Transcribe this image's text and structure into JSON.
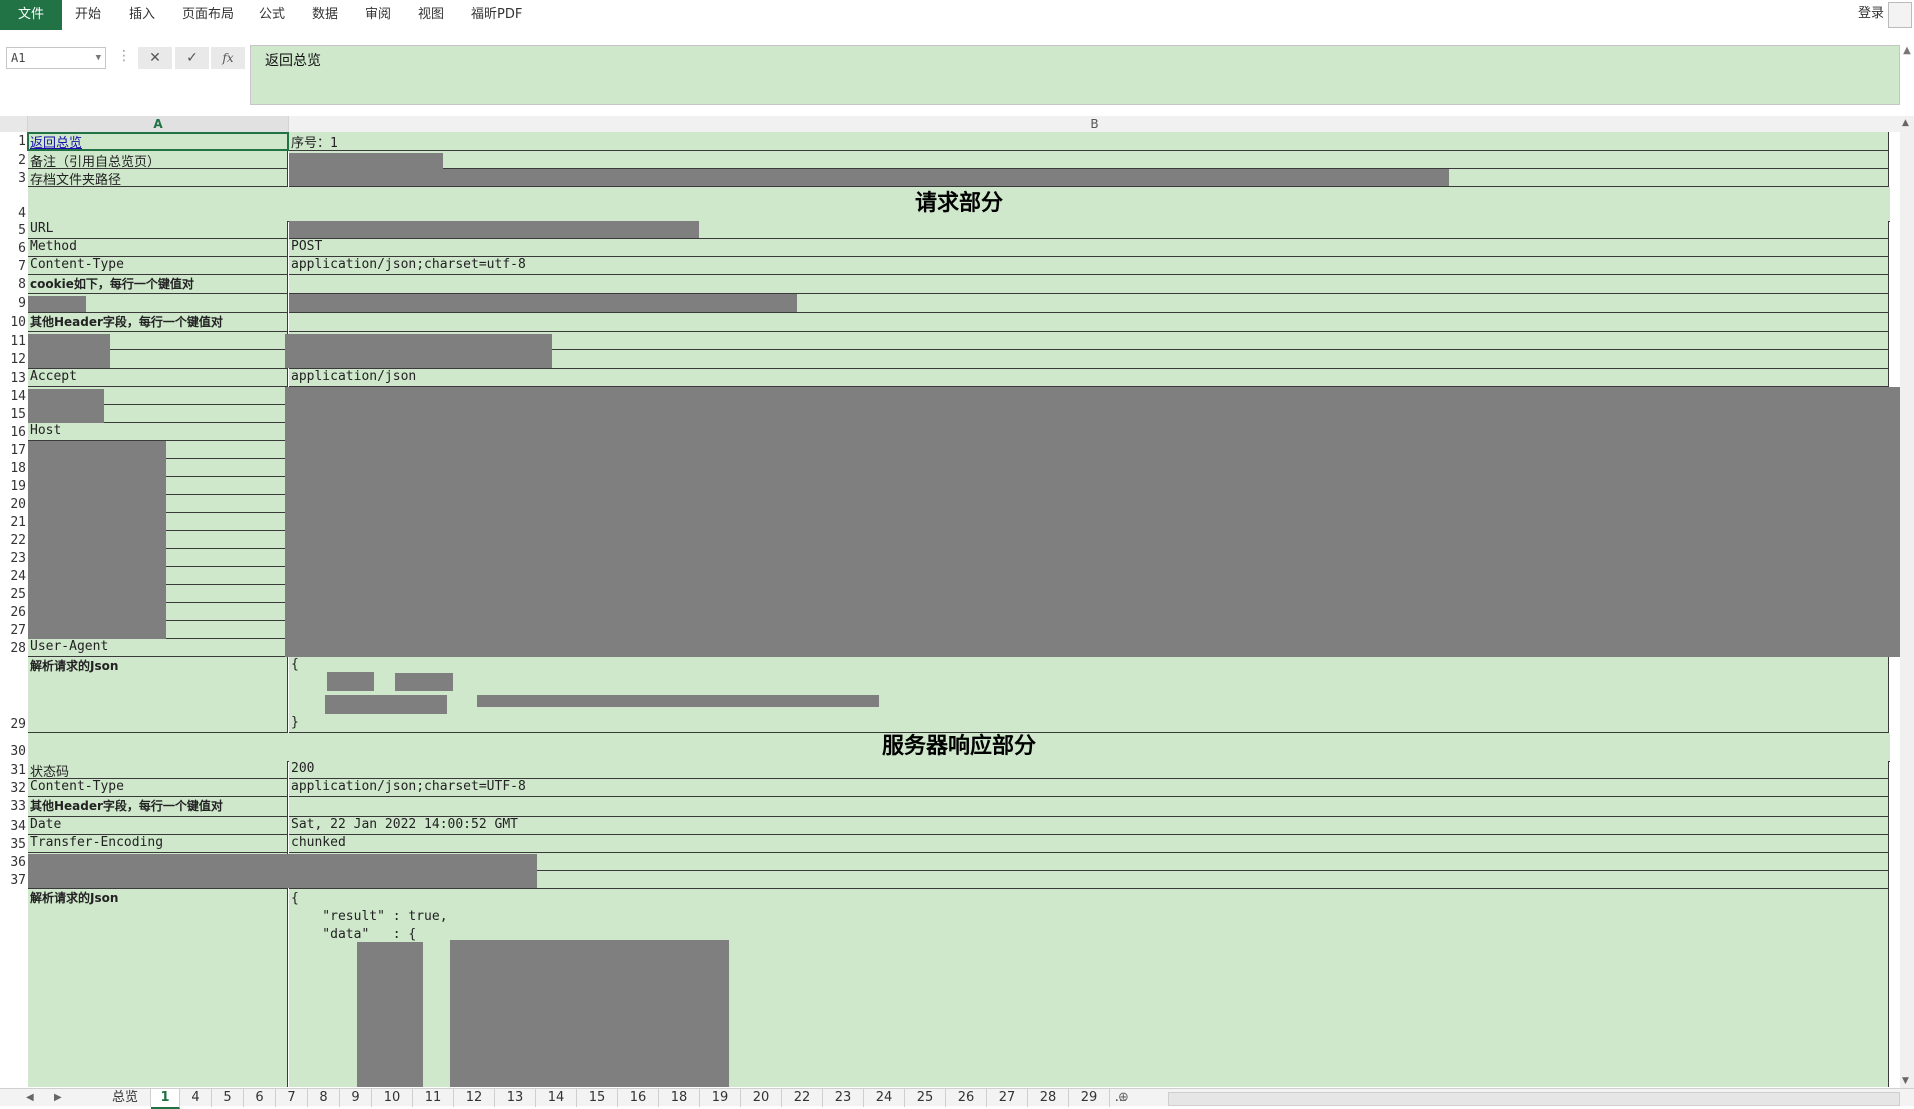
{
  "ribbon": {
    "tabs": [
      "文件",
      "开始",
      "插入",
      "页面布局",
      "公式",
      "数据",
      "审阅",
      "视图",
      "福昕PDF"
    ],
    "login": "登录"
  },
  "formula_bar": {
    "name_box": "A1",
    "cancel_icon": "✕",
    "enter_icon": "✓",
    "fx_label": "fx",
    "content": "返回总览"
  },
  "columns": [
    "A",
    "B"
  ],
  "rows": {
    "r1": {
      "num": "1",
      "a": "返回总览",
      "b": "序号：1"
    },
    "r2": {
      "num": "2",
      "a": "备注（引用自总览页）"
    },
    "r3": {
      "num": "3",
      "a": "存档文件夹路径"
    },
    "r4": {
      "num": "4",
      "section": "请求部分"
    },
    "r5": {
      "num": "5",
      "a": "URL"
    },
    "r6": {
      "num": "6",
      "a": "Method",
      "b": "POST"
    },
    "r7": {
      "num": "7",
      "a": "Content-Type",
      "b": "application/json;charset=utf-8"
    },
    "r8": {
      "num": "8",
      "a": "cookie如下，每行一个键值对"
    },
    "r9": {
      "num": "9"
    },
    "r10": {
      "num": "10",
      "a": "其他Header字段，每行一个键值对"
    },
    "r11": {
      "num": "11"
    },
    "r12": {
      "num": "12"
    },
    "r13": {
      "num": "13",
      "a": "Accept",
      "b": "application/json"
    },
    "r14": {
      "num": "14"
    },
    "r15": {
      "num": "15"
    },
    "r16": {
      "num": "16",
      "a": "Host"
    },
    "r17": {
      "num": "17"
    },
    "r18": {
      "num": "18"
    },
    "r19": {
      "num": "19"
    },
    "r20": {
      "num": "20"
    },
    "r21": {
      "num": "21"
    },
    "r22": {
      "num": "22"
    },
    "r23": {
      "num": "23"
    },
    "r24": {
      "num": "24"
    },
    "r25": {
      "num": "25"
    },
    "r26": {
      "num": "26"
    },
    "r27": {
      "num": "27"
    },
    "r28": {
      "num": "28",
      "a": "User-Agent"
    },
    "r29": {
      "num": "29",
      "a": "解析请求的Json",
      "b_open": "{",
      "b_close": "}"
    },
    "r30": {
      "num": "30",
      "section": "服务器响应部分"
    },
    "r31": {
      "num": "31",
      "a": "状态码",
      "b": "200"
    },
    "r32": {
      "num": "32",
      "a": "Content-Type",
      "b": "application/json;charset=UTF-8"
    },
    "r33": {
      "num": "33",
      "a": "其他Header字段，每行一个键值对"
    },
    "r34": {
      "num": "34",
      "a": "Date",
      "b": "Sat, 22 Jan 2022 14:00:52 GMT"
    },
    "r35": {
      "num": "35",
      "a": "Transfer-Encoding",
      "b": "chunked"
    },
    "r36": {
      "num": "36"
    },
    "r37": {
      "num": "37"
    },
    "r38": {
      "a": "解析请求的Json",
      "b_line1": "{",
      "b_line2": "    \"result\" : true,",
      "b_line3": "    \"data\"   : {"
    }
  },
  "sheet_tabs": [
    "总览",
    "1",
    "4",
    "5",
    "6",
    "7",
    "8",
    "9",
    "10",
    "11",
    "12",
    "13",
    "14",
    "15",
    "16",
    "18",
    "19",
    "20",
    "22",
    "23",
    "24",
    "25",
    "26",
    "27",
    "28",
    "29",
    "..."
  ],
  "active_sheet": "1"
}
